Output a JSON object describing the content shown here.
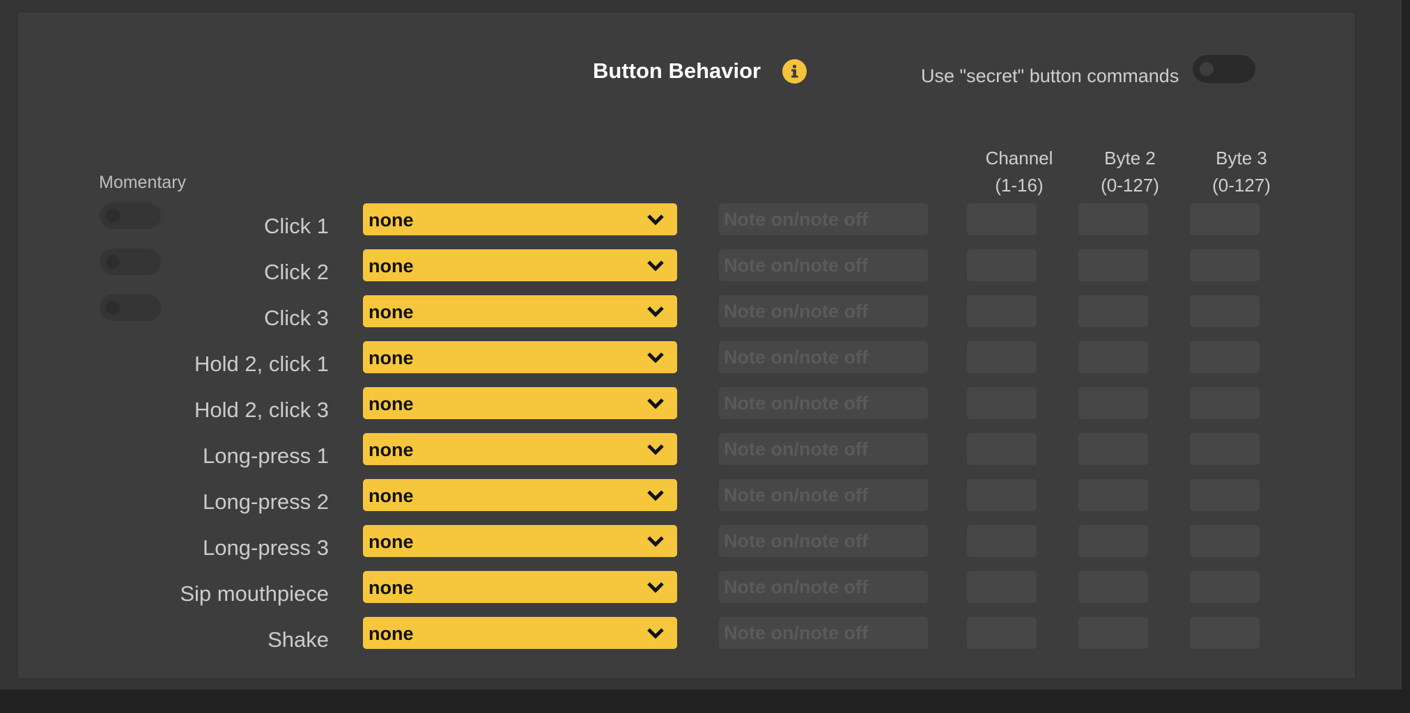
{
  "header": {
    "title": "Button Behavior",
    "secret_label": "Use \"secret\" button commands"
  },
  "momentary_label": "Momentary",
  "columns": {
    "channel": {
      "line1": "Channel",
      "line2": "(1-16)"
    },
    "byte2": {
      "line1": "Byte 2",
      "line2": "(0-127)"
    },
    "byte3": {
      "line1": "Byte 3",
      "line2": "(0-127)"
    }
  },
  "rows": [
    {
      "label": "Click 1",
      "value": "none",
      "note_placeholder": "Note on/note off"
    },
    {
      "label": "Click 2",
      "value": "none",
      "note_placeholder": "Note on/note off"
    },
    {
      "label": "Click 3",
      "value": "none",
      "note_placeholder": "Note on/note off"
    },
    {
      "label": "Hold 2, click 1",
      "value": "none",
      "note_placeholder": "Note on/note off"
    },
    {
      "label": "Hold 2, click 3",
      "value": "none",
      "note_placeholder": "Note on/note off"
    },
    {
      "label": "Long-press 1",
      "value": "none",
      "note_placeholder": "Note on/note off"
    },
    {
      "label": "Long-press 2",
      "value": "none",
      "note_placeholder": "Note on/note off"
    },
    {
      "label": "Long-press 3",
      "value": "none",
      "note_placeholder": "Note on/note off"
    },
    {
      "label": "Sip mouthpiece",
      "value": "none",
      "note_placeholder": "Note on/note off"
    },
    {
      "label": "Shake",
      "value": "none",
      "note_placeholder": "Note on/note off"
    }
  ],
  "colors": {
    "accent": "#f6c63c",
    "panel": "#3d3d3d",
    "field": "#474747"
  },
  "icons": {
    "info": "info-icon",
    "dropdown": "chevron-down-icon"
  }
}
